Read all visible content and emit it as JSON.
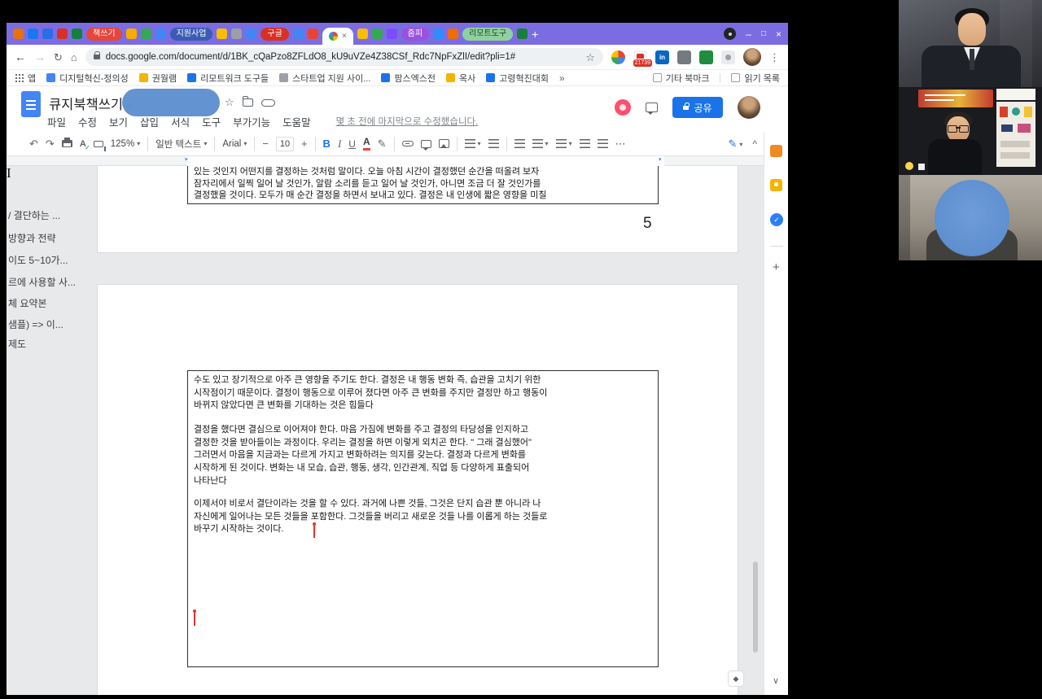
{
  "icons": {
    "undo": "↶",
    "redo": "↷",
    "caret": "▾",
    "minus": "−",
    "plus": "+",
    "more": "⋯",
    "chevron_up": "^",
    "chevron_down": "∨",
    "star": "☆",
    "kebab": "⋮",
    "back": "←",
    "forward": "→",
    "reload": "↻",
    "home": "⌂",
    "close": "×",
    "minimize": "–",
    "maximize": "□",
    "overflow": "»",
    "check": "✓",
    "bold": "B",
    "italic": "I",
    "underline": "U",
    "text_color": "A",
    "pencil": "✎",
    "ibeam": "I",
    "linkedin": "in",
    "explore": "◆"
  },
  "tabstrip": {
    "groups": [
      {
        "label": "책쓰기",
        "color": "#e8453c"
      },
      {
        "label": "지원사업",
        "color": "#3b5bb5"
      },
      {
        "label": "구글",
        "color": "#d93025"
      },
      {
        "label": "줌피",
        "color": "#9b51e0"
      },
      {
        "label": "리모트도구",
        "color": "#8fd19e"
      }
    ]
  },
  "navbar": {
    "url": "docs.google.com/document/d/1BK_cQaPzo8ZFLdO8_kU9uVZe4Z38CSf_Rdc7NpFxZlI/edit?pli=1#",
    "ext_badge": "21739"
  },
  "bookmarks": {
    "apps_label": "앱",
    "items": [
      "디지털혁신-정의성",
      "권월램",
      "리모트워크 도구들",
      "스타트업 지원 사이...",
      "팜스엑스전",
      "옥사",
      "고령혁진대회"
    ],
    "right": [
      "기타 북마크",
      "읽기 목록"
    ]
  },
  "docs": {
    "title": "큐지북책쓰기 -",
    "menus": [
      "파일",
      "수정",
      "보기",
      "삽입",
      "서식",
      "도구",
      "부가기능",
      "도움말"
    ],
    "status": "몇 초 전에 마지막으로 수정했습니다.",
    "share_label": "공유",
    "toolbar": {
      "zoom": "125%",
      "style": "일반 텍스트",
      "font": "Arial",
      "size": "10"
    },
    "outline": [
      "/ 결단하는 ...",
      "방향과 전략",
      "이도 5~10가...",
      "르에 사용할 사...",
      "체 요약본",
      "샘플) => 이...",
      "제도"
    ],
    "page_number": "5",
    "page1_lines": [
      "있는 것인지 어떤지를 결정하는 것처럼 말이다. 오늘 아침 시간이 결정했던 순간을 떠올려 보자",
      "잠자리에서 일찍 일어 날 것인가, 알람 소리를 듣고 일어 날 것인가, 아니면 조금 더 잘 것인가를",
      "결정했을 것이다. 모두가 매 순간 결정을 하면서 보내고 있다. 결정은 내 인생에 짧은 영향을 미칠"
    ],
    "page2": {
      "p1": [
        "수도 있고 장기적으로 아주 큰 영향을 주기도 한다. 결정은 내 행동 변화 즉, 습관을 고치기 위한",
        "시작점이기 때문이다. 결정이 행동으로 이루어 졌다면 아주 큰 변화를 주지만 결정만 하고 행동이",
        "바뀌지 않았다면 큰 변화를 기대하는 것은 힘들다"
      ],
      "p2": [
        "결정을 했다면 결심으로 이어져야 한다. 마음 가짐에 변화를 주고 결정의 타당성을 인지하고",
        "결정한 것을 받아들이는 과정이다. 우리는 결정을 하면 이렇게 외치곤 한다. \" 그래 결심했어\"",
        "그러면서 마음을 지금과는 다르게 가지고 변화하려는 의지를 갖는다. 결정과 다르게 변화를",
        "시작하게 된 것이다. 변화는 내 모습, 습관, 행동, 생각, 인간관계, 직업 등 다양하게 표출되어",
        "나타난다"
      ],
      "p3": [
        "이제서야 비로서 결단이라는 것을 할 수 있다. 과거에 나쁜 것들, 그것은 단지 습관 뿐 아니라 나",
        "자신에게 일어나는 모든 것들을 포함한다. 그것들을 버리고 새로운 것들 나를 이롭게 하는 것들로",
        "바꾸기 시작하는 것이다."
      ]
    }
  },
  "colors": {
    "titlebar": "#7b6de1",
    "share_button": "#1a73e8",
    "privacy_blob": "#5f8fd0",
    "cursor_red": "#e03131"
  }
}
